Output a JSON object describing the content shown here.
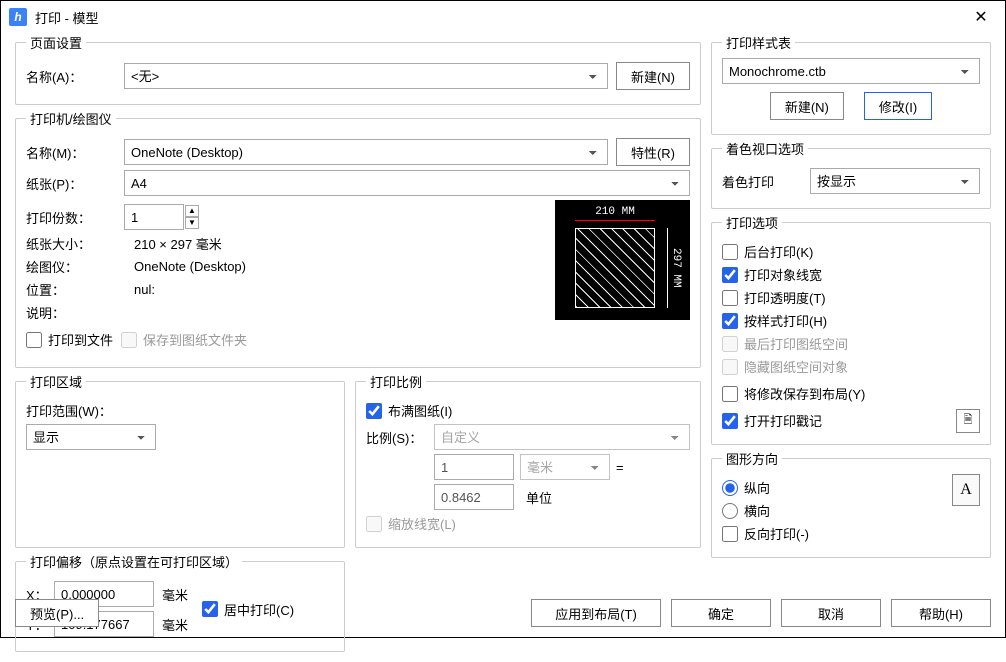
{
  "window": {
    "title": "打印 - 模型"
  },
  "page_setup": {
    "legend": "页面设置",
    "name_label": "名称(A)：",
    "name_value": "<无>",
    "new_button": "新建(N)"
  },
  "printer": {
    "legend": "打印机/绘图仪",
    "name_label": "名称(M)：",
    "name_value": "OneNote (Desktop)",
    "props_button": "特性(R)",
    "paper_label": "纸张(P)：",
    "paper_value": "A4",
    "copies_label": "打印份数：",
    "copies_value": "1",
    "paper_size_label": "纸张大小：",
    "paper_size_value": "210 × 297 毫米",
    "plotter_label": "绘图仪：",
    "plotter_value": "OneNote (Desktop)",
    "location_label": "位置：",
    "location_value": "nul:",
    "desc_label": "说明：",
    "print_to_file": "打印到文件",
    "save_to_sheet": "保存到图纸文件夹",
    "preview_dim_w": "210 MM",
    "preview_dim_h": "297 MM"
  },
  "area": {
    "legend": "打印区域",
    "range_label": "打印范围(W)：",
    "range_value": "显示"
  },
  "scale": {
    "legend": "打印比例",
    "fit_label": "布满图纸(I)",
    "ratio_label": "比例(S)：",
    "ratio_value": "自定义",
    "num_value": "1",
    "num_unit": "毫米",
    "eq": "=",
    "den_value": "0.8462",
    "den_unit": "单位",
    "scale_lw": "缩放线宽(L)"
  },
  "offset": {
    "legend": "打印偏移（原点设置在可打印区域）",
    "x_label": "X：",
    "x_value": "0.000000",
    "x_unit": "毫米",
    "y_label": "Y：",
    "y_value": "109.177667",
    "y_unit": "毫米",
    "center_label": "居中打印(C)"
  },
  "style": {
    "legend": "打印样式表",
    "value": "Monochrome.ctb",
    "new_button": "新建(N)",
    "modify_button": "修改(I)"
  },
  "shaded": {
    "legend": "着色视口选项",
    "label": "着色打印",
    "value": "按显示"
  },
  "options": {
    "legend": "打印选项",
    "bg": "后台打印(K)",
    "lw": "打印对象线宽",
    "trans": "打印透明度(T)",
    "bystyle": "按样式打印(H)",
    "last": "最后打印图纸空间",
    "hide": "隐藏图纸空间对象",
    "savelayout": "将修改保存到布局(Y)",
    "stamp": "打开打印戳记"
  },
  "orient": {
    "legend": "图形方向",
    "portrait": "纵向",
    "landscape": "横向",
    "reverse": "反向打印(-)",
    "icon_letter": "A"
  },
  "footer": {
    "preview": "预览(P)...",
    "apply": "应用到布局(T)",
    "ok": "确定",
    "cancel": "取消",
    "help": "帮助(H)"
  }
}
